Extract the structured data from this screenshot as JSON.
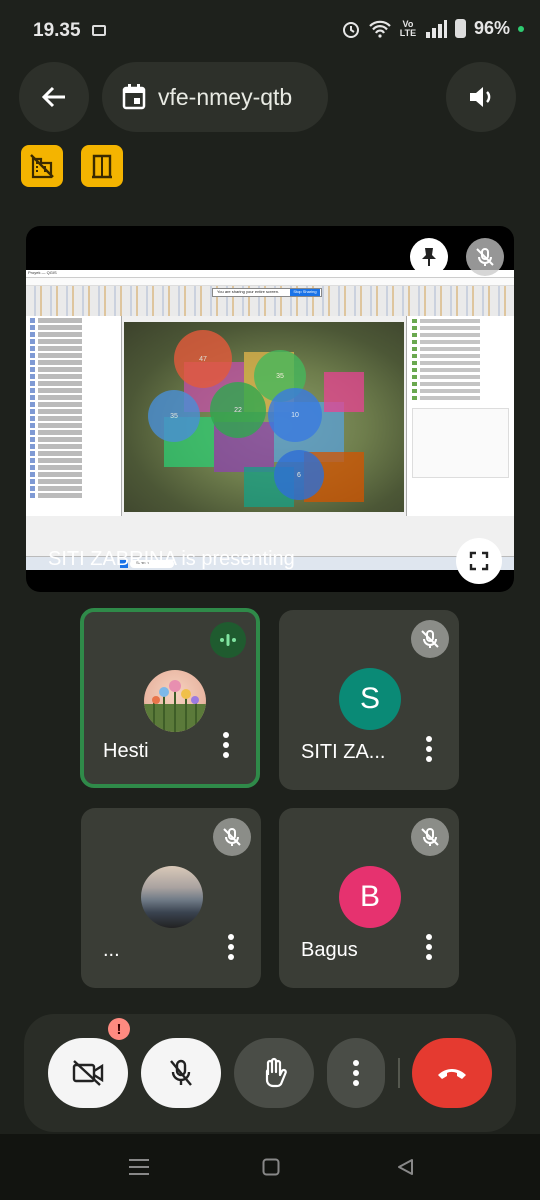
{
  "status": {
    "time": "19.35",
    "network": "Vo LTE",
    "battery": "96%"
  },
  "meeting": {
    "code": "vfe-nmey-qtb"
  },
  "presentation": {
    "presenter_text": "SITI ZABRINA  is presenting",
    "qgis_title": "Proyek — QGIS",
    "sharing_notice": "You are sharing your entire screen.",
    "stop_sharing": "Stop Sharing",
    "taskbar_search": "Search",
    "map_circles": [
      "47",
      "35",
      "22",
      "35",
      "10",
      "6"
    ]
  },
  "participants": [
    {
      "name": "Hesti",
      "initial": "",
      "color": "#e9b7a3",
      "speaking": true,
      "muted": false
    },
    {
      "name": "SITI ZA...",
      "initial": "S",
      "color": "#0a8a76",
      "speaking": false,
      "muted": true
    },
    {
      "name": "...",
      "initial": "",
      "color": "#6f7a86",
      "speaking": false,
      "muted": true
    },
    {
      "name": "Bagus",
      "initial": "B",
      "color": "#e6326f",
      "speaking": false,
      "muted": true
    }
  ],
  "controls": {
    "camera_alert": "!"
  },
  "colors": {
    "accent_yellow": "#f4b400",
    "end_call_red": "#e53a30",
    "speaking_green": "#2f8a49"
  }
}
